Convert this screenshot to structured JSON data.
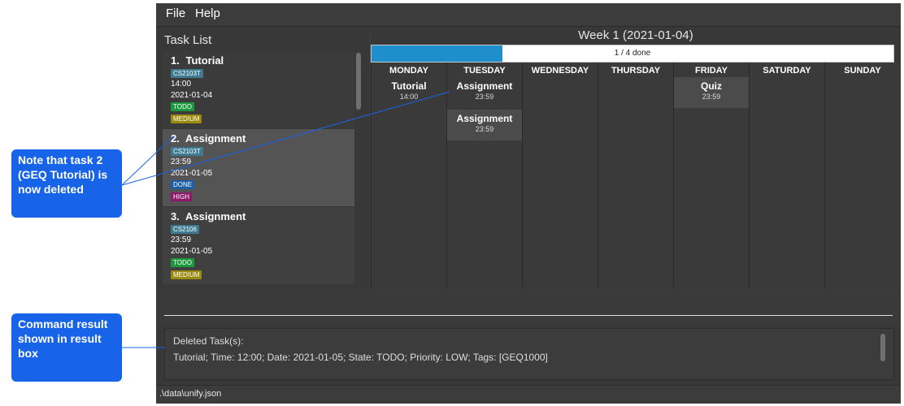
{
  "menu": {
    "file": "File",
    "help": "Help"
  },
  "task_list": {
    "title": "Task List",
    "tasks": [
      {
        "number": "1.",
        "name": "Tutorial",
        "tag": "CS2103T",
        "time": "14:00",
        "date": "2021-01-04",
        "state": "TODO",
        "priority": "MEDIUM"
      },
      {
        "number": "2.",
        "name": "Assignment",
        "tag": "CS2103T",
        "time": "23:59",
        "date": "2021-01-05",
        "state": "DONE",
        "priority": "HIGH"
      },
      {
        "number": "3.",
        "name": "Assignment",
        "tag": "CS2106",
        "time": "23:59",
        "date": "2021-01-05",
        "state": "TODO",
        "priority": "MEDIUM"
      }
    ]
  },
  "week": {
    "title": "Week 1 (2021-01-04)",
    "progress_label": "1 / 4 done",
    "progress_fraction": 0.25,
    "days": [
      "MONDAY",
      "TUESDAY",
      "WEDNESDAY",
      "THURSDAY",
      "FRIDAY",
      "SATURDAY",
      "SUNDAY"
    ],
    "entries": {
      "monday": [
        {
          "title": "Tutorial",
          "time": "14:00"
        }
      ],
      "tuesday": [
        {
          "title": "Assignment",
          "time": "23:59"
        },
        {
          "title": "Assignment",
          "time": "23:59"
        }
      ],
      "friday": [
        {
          "title": "Quiz",
          "time": "23:59"
        }
      ]
    }
  },
  "command": {
    "value": ""
  },
  "result": {
    "line1": "Deleted Task(s):",
    "line2": "Tutorial; Time: 12:00; Date: 2021-01-05; State: TODO; Priority: LOW; Tags: [GEQ1000]"
  },
  "status": {
    "path": ".\\data\\unify.json"
  },
  "annotations": {
    "deleted_note": "Note that task 2 (GEQ Tutorial) is now deleted",
    "result_note": "Command result shown in result box"
  },
  "colors": {
    "accent": "#1f8fcb",
    "callout": "#1764e8",
    "todo": "#1a9a3c",
    "done": "#1a5fa8",
    "medium": "#9a8a10",
    "high": "#8c1a6a"
  }
}
